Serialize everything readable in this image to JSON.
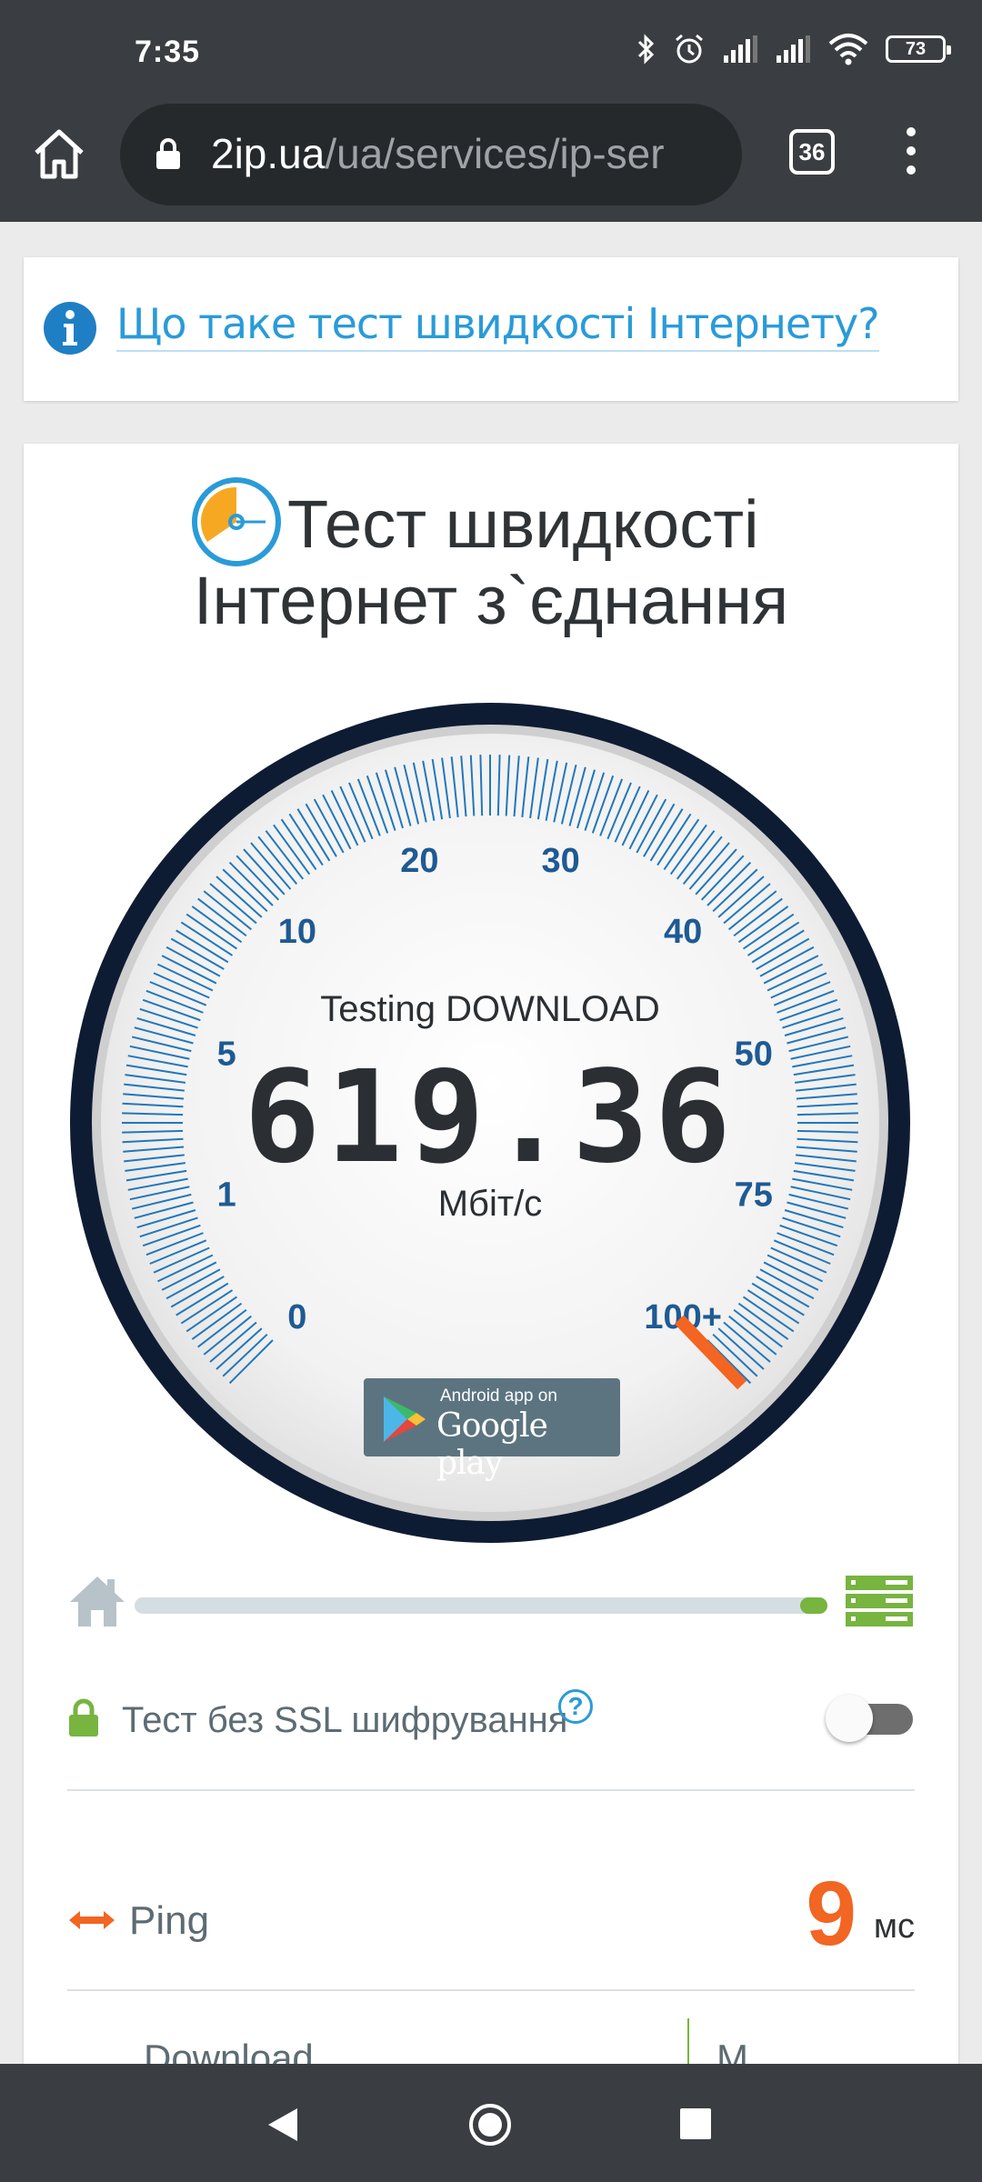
{
  "status_bar": {
    "time": "7:35",
    "battery": "73",
    "icons": [
      "bluetooth-icon",
      "alarm-icon",
      "signal-icon",
      "signal-icon",
      "wifi-icon",
      "battery-icon"
    ]
  },
  "browser": {
    "url_host": "2ip.ua",
    "url_path": "/ua/services/ip-ser",
    "tab_count": "36"
  },
  "info_card": {
    "link_text": "Що таке тест швидкості Інтернету?"
  },
  "main": {
    "title_line1": "Тест швидкості",
    "title_line2": "Інтернет з`єднання"
  },
  "gauge": {
    "status": "Testing DOWNLOAD",
    "value": "619.36",
    "unit": "Мбіт/с",
    "scale_labels": [
      "0",
      "1",
      "5",
      "10",
      "20",
      "30",
      "40",
      "50",
      "75",
      "100+"
    ],
    "needle_value": "100+",
    "colors": {
      "dark_ring": "#0e1c33",
      "ticks": "#2277bb",
      "labels": "#1e5a94",
      "needle": "#f26522"
    }
  },
  "google_play": {
    "small_text": "Android app on",
    "big_text": "Google play"
  },
  "progress": {
    "fraction": 0.04,
    "color": "#77b440"
  },
  "ssl": {
    "label": "Тест без SSL шифрування",
    "help": "?",
    "enabled": false
  },
  "ping": {
    "label": "Ping",
    "value": "9",
    "unit": "мс"
  },
  "results": {
    "download_label": "Download",
    "upload_label": "M"
  }
}
